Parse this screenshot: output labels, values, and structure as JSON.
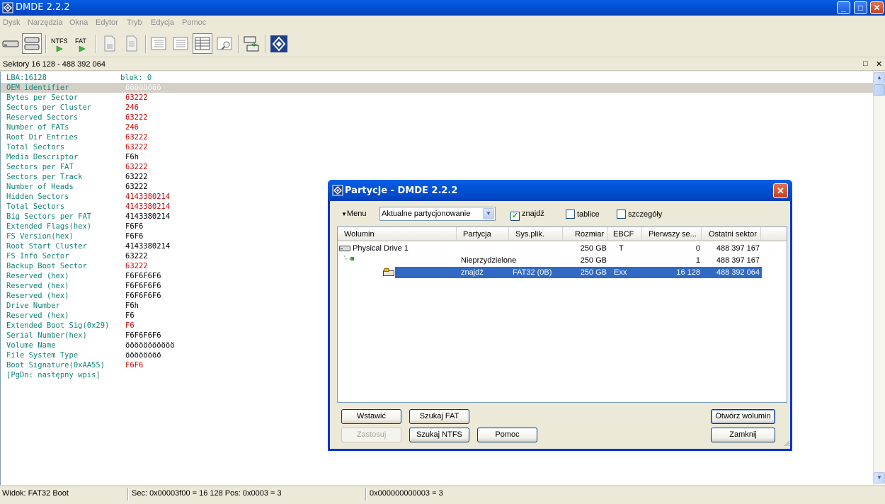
{
  "window": {
    "title": "DMDE 2.2.2"
  },
  "menu": [
    "Dysk",
    "Narzędzia",
    "Okna",
    "Edytor",
    "Tryb",
    "Edycja",
    "Pomoc"
  ],
  "toolbar": {
    "ntfs_label": "NTFS",
    "fat_label": "FAT"
  },
  "sectors_header": "Sektory 16 128 - 488 392 064",
  "panel": {
    "lba": "LBA:16128",
    "blok": "blok: 0",
    "rows": [
      {
        "k": "OEM identifier",
        "v": "öööööööö",
        "style": "gray"
      },
      {
        "k": "Bytes per Sector",
        "v": "63222",
        "style": "red"
      },
      {
        "k": "Sectors per Cluster",
        "v": "246",
        "style": "red"
      },
      {
        "k": "Reserved Sectors",
        "v": "63222",
        "style": "red"
      },
      {
        "k": "Number of FATs",
        "v": "246",
        "style": "red"
      },
      {
        "k": "Root Dir Entries",
        "v": "63222",
        "style": "red"
      },
      {
        "k": "Total Sectors",
        "v": "63222",
        "style": "red"
      },
      {
        "k": "Media Descriptor",
        "v": "F6h",
        "style": ""
      },
      {
        "k": "Sectors per FAT",
        "v": "63222",
        "style": "red"
      },
      {
        "k": "Sectors per Track",
        "v": "63222",
        "style": ""
      },
      {
        "k": "Number of Heads",
        "v": "63222",
        "style": ""
      },
      {
        "k": "Hidden Sectors",
        "v": "4143380214",
        "style": "red"
      },
      {
        "k": "Total Sectors",
        "v": "4143380214",
        "style": "red"
      },
      {
        "k": "Big Sectors per FAT",
        "v": "4143380214",
        "style": ""
      },
      {
        "k": "Extended Flags(hex)",
        "v": "F6F6",
        "style": ""
      },
      {
        "k": "FS Version(hex)",
        "v": "F6F6",
        "style": ""
      },
      {
        "k": "Root Start Cluster",
        "v": "4143380214",
        "style": ""
      },
      {
        "k": "FS Info Sector",
        "v": "63222",
        "style": ""
      },
      {
        "k": "Backup Boot Sector",
        "v": "63222",
        "style": "red"
      },
      {
        "k": "Reserved (hex)",
        "v": "F6F6F6F6",
        "style": ""
      },
      {
        "k": "Reserved (hex)",
        "v": "F6F6F6F6",
        "style": ""
      },
      {
        "k": "Reserved (hex)",
        "v": "F6F6F6F6",
        "style": ""
      },
      {
        "k": "Drive Number",
        "v": "F6h",
        "style": ""
      },
      {
        "k": "Reserved (hex)",
        "v": "F6",
        "style": ""
      },
      {
        "k": "Extended Boot Sig(0x29)",
        "v": "F6",
        "style": "red"
      },
      {
        "k": "Serial Number(hex)",
        "v": "F6F6F6F6",
        "style": ""
      },
      {
        "k": "Volume Name",
        "v": "ööööööööööö",
        "style": ""
      },
      {
        "k": "File System Type",
        "v": "öööööööö",
        "style": ""
      },
      {
        "k": "Boot Signature(0xAA55)",
        "v": "F6F6",
        "style": "red"
      }
    ],
    "footer": "[PgDn: następny wpis]"
  },
  "statusbar": {
    "view": "Widok: FAT32 Boot",
    "sec": "Sec: 0x00003f00 = 16 128  Pos: 0x0003 = 3",
    "hexval": "0x000000000003 = 3"
  },
  "dialog": {
    "title": "Partycje - DMDE 2.2.2",
    "menu_label": "Menu",
    "select_value": "Aktualne partycjonowanie",
    "checkboxes": [
      {
        "label": "znajdź",
        "checked": true
      },
      {
        "label": "tablice",
        "checked": false
      },
      {
        "label": "szczegóły",
        "checked": false
      }
    ],
    "columns": [
      "Wolumin",
      "Partycja",
      "Sys.plik.",
      "Rozmiar",
      "EBCF",
      "Pierwszy se...",
      "Ostatni sektor"
    ],
    "rows": [
      {
        "wolumin": "Physical Drive 1",
        "partycja": "",
        "sys": "",
        "rozmiar": "250 GB",
        "ebcf": "T",
        "first": "0",
        "last": "488 397 167"
      },
      {
        "wolumin": "",
        "partycja": "Nieprzydzielone",
        "sys": "",
        "rozmiar": "250 GB",
        "ebcf": "",
        "first": "1",
        "last": "488 397 167"
      },
      {
        "wolumin": "",
        "partycja": "znajdź",
        "sys": "FAT32 (0B)",
        "rozmiar": "250 GB",
        "ebcf": "Exx",
        "first": "16 128",
        "last": "488 392 064"
      }
    ],
    "buttons": {
      "insert": "Wstawić",
      "apply": "Zastosuj",
      "search_fat": "Szukaj FAT",
      "search_ntfs": "Szukaj NTFS",
      "help": "Pomoc",
      "open_volume": "Otwórz wolumin",
      "close": "Zamknij"
    }
  },
  "colors": {
    "field_name": "#138477",
    "value_warning": "#d40000",
    "selection": "#316ac5",
    "title_bar": "#0053d6"
  }
}
